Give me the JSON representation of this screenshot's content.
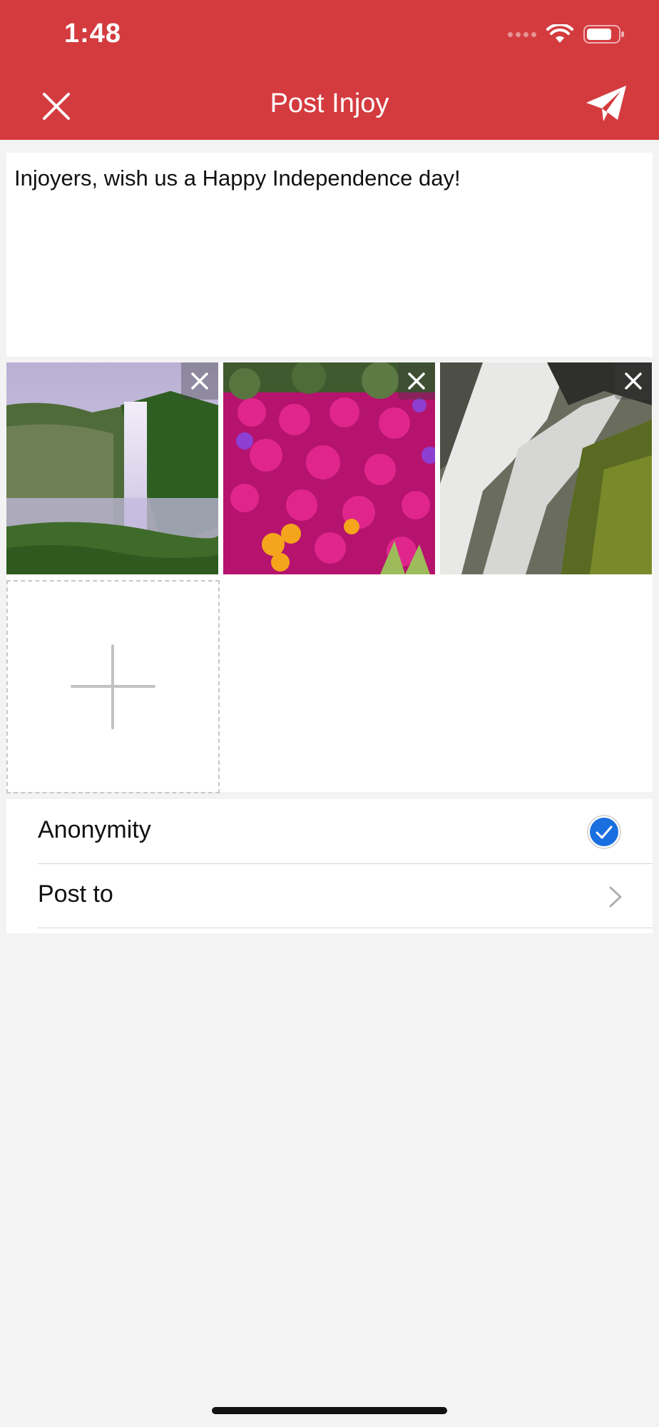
{
  "status_bar": {
    "time": "1:48"
  },
  "header": {
    "title": "Post Injoy"
  },
  "editor": {
    "text": "Injoyers, wish us a Happy Independence day!"
  },
  "photos": [
    {
      "name": "waterfall-cliff-photo"
    },
    {
      "name": "pink-flowers-photo"
    },
    {
      "name": "rocky-waterfall-photo"
    }
  ],
  "settings": {
    "anonymity_label": "Anonymity",
    "anonymity_checked": true,
    "post_to_label": "Post to"
  },
  "colors": {
    "header": "#d43b3f",
    "check": "#1a6fe0",
    "background": "#f3f3f3"
  }
}
